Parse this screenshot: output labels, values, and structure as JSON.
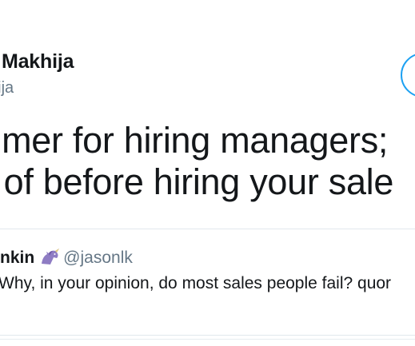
{
  "tweet": {
    "author_name": "ar Makhija",
    "author_handle": "hija",
    "text_lines": [
      "primer for hiring managers;",
      "re of before hiring your sale"
    ]
  },
  "quote": {
    "author_name": "nkin",
    "author_emoji": "unicorn-icon",
    "author_handle": "@jasonlk",
    "text": "Why, in your opinion, do most sales people fail? quor"
  },
  "colors": {
    "text_primary": "#14171a",
    "text_secondary": "#657786",
    "accent": "#1da1f2",
    "border": "#e1e8ed"
  }
}
